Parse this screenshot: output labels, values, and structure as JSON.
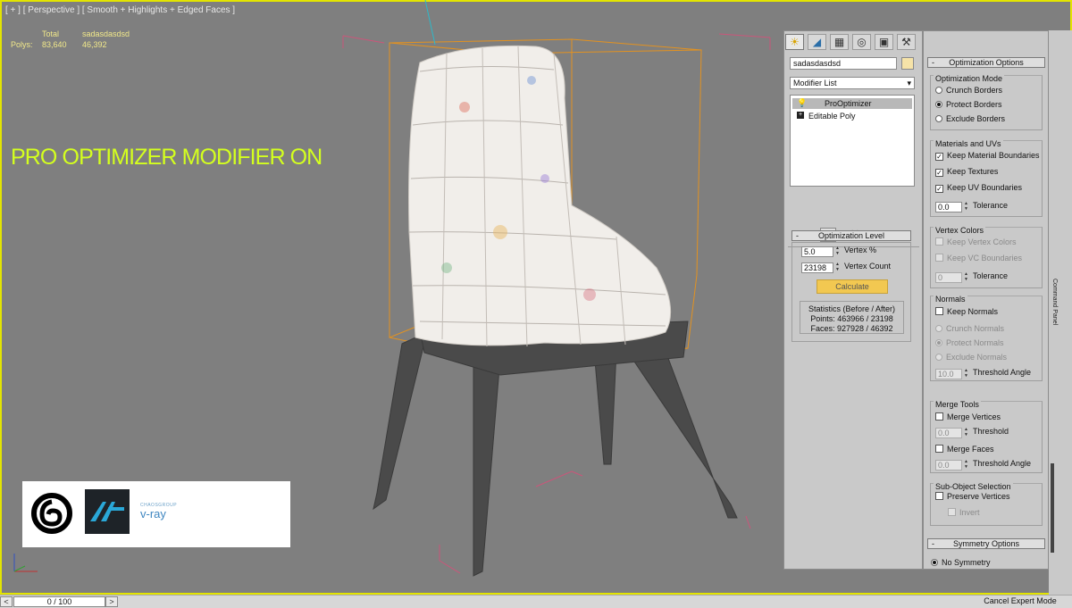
{
  "viewport": {
    "label": "[ + ] [ Perspective ] [ Smooth + Highlights + Edged Faces ]",
    "stats": {
      "header_name": "sadasdasdsd",
      "total_label": "Total",
      "polys_label": "Polys:",
      "polys_total": "83,640",
      "polys_selected": "46,392"
    },
    "overlay_text": "PRO OPTIMIZER MODIFIER ON",
    "logos": [
      "3ds-max-logo",
      "autodesk-logo",
      "vray-logo"
    ],
    "vray_small": "CHAOSGROUP",
    "vray_name": "v-ray"
  },
  "timeline": {
    "prev_label": "<",
    "next_label": ">",
    "frame": "0 / 100",
    "cancel_expert": "Cancel Expert Mode"
  },
  "command_panel": {
    "strip_label": "Command Panel",
    "tabs": [
      "create-icon",
      "modify-icon",
      "hierarchy-icon",
      "motion-icon",
      "display-icon",
      "utilities-icon"
    ],
    "object_name": "sadasdasdsd",
    "object_color": "#f6e3a8",
    "modifier_list_label": "Modifier List",
    "stack": [
      "ProOptimizer",
      "Editable Poly"
    ],
    "optimization_level": {
      "title": "Optimization Level",
      "vertex_pct_value": "5.0",
      "vertex_pct_label": "Vertex %",
      "vertex_count_value": "23198",
      "vertex_count_label": "Vertex Count",
      "calculate": "Calculate",
      "statistics_title": "Statistics (Before / After)",
      "points": "Points: 463966 / 23198",
      "faces": "Faces: 927928 / 46392"
    },
    "optimization_options": {
      "title": "Optimization Options",
      "mode": {
        "label": "Optimization Mode",
        "options": [
          "Crunch Borders",
          "Protect Borders",
          "Exclude Borders"
        ],
        "selected": "Protect Borders"
      },
      "materials": {
        "label": "Materials and UVs",
        "keep_material_boundaries": "Keep Material Boundaries",
        "keep_textures": "Keep Textures",
        "keep_uv_boundaries": "Keep UV Boundaries",
        "tolerance_value": "0.0",
        "tolerance_label": "Tolerance"
      },
      "vertex_colors": {
        "label": "Vertex Colors",
        "keep_vertex_colors": "Keep Vertex Colors",
        "keep_vc_boundaries": "Keep VC Boundaries",
        "tolerance_value": "0",
        "tolerance_label": "Tolerance"
      },
      "normals": {
        "label": "Normals",
        "keep_normals": "Keep Normals",
        "options": [
          "Crunch Normals",
          "Protect Normals",
          "Exclude Normals"
        ],
        "selected": "Protect Normals",
        "threshold_value": "10.0",
        "threshold_label": "Threshold Angle"
      },
      "merge_tools": {
        "label": "Merge Tools",
        "merge_vertices": "Merge Vertices",
        "vertices_threshold_value": "0.0",
        "vertices_threshold_label": "Threshold",
        "merge_faces": "Merge Faces",
        "faces_threshold_value": "0.0",
        "faces_threshold_label": "Threshold Angle"
      },
      "sub_object": {
        "label": "Sub-Object Selection",
        "preserve_vertices": "Preserve Vertices",
        "invert": "Invert"
      }
    },
    "symmetry_options": {
      "title": "Symmetry Options",
      "no_symmetry": "No Symmetry"
    }
  }
}
